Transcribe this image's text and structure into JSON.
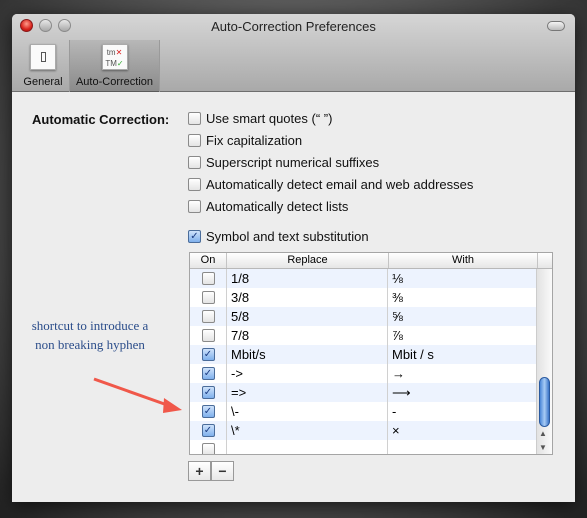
{
  "window": {
    "title": "Auto-Correction Preferences"
  },
  "toolbar": {
    "tabs": [
      {
        "label": "General",
        "selected": false
      },
      {
        "label": "Auto-Correction",
        "selected": true
      }
    ],
    "autocorrect_icon": {
      "top": "tm",
      "bottom": "TM"
    }
  },
  "section": {
    "label": "Automatic Correction:"
  },
  "options": [
    {
      "label": "Use smart quotes (“ ”)",
      "checked": false
    },
    {
      "label": "Fix capitalization",
      "checked": false
    },
    {
      "label": "Superscript numerical suffixes",
      "checked": false
    },
    {
      "label": "Automatically detect email and web addresses",
      "checked": false
    },
    {
      "label": "Automatically detect lists",
      "checked": false
    },
    {
      "label": "Symbol and text substitution",
      "checked": true
    }
  ],
  "table": {
    "headers": [
      "On",
      "Replace",
      "With"
    ],
    "rows": [
      {
        "on": false,
        "replace": "1/8",
        "with": "⅛"
      },
      {
        "on": false,
        "replace": "3/8",
        "with": "⅜"
      },
      {
        "on": false,
        "replace": "5/8",
        "with": "⅝"
      },
      {
        "on": false,
        "replace": "7/8",
        "with": "⅞"
      },
      {
        "on": true,
        "replace": "Mbit/s",
        "with": "Mbit / s"
      },
      {
        "on": true,
        "replace": "->",
        "with": "→"
      },
      {
        "on": true,
        "replace": "=>",
        "with": "⟶"
      },
      {
        "on": true,
        "replace": "\\-",
        "with": "‑"
      },
      {
        "on": true,
        "replace": "\\*",
        "with": "×"
      },
      {
        "on": false,
        "replace": "",
        "with": ""
      }
    ]
  },
  "buttons": {
    "add": "+",
    "remove": "−"
  },
  "annotation": {
    "text": "shortcut to introduce a non breaking hyphen",
    "color": "#2b4d8a",
    "arrow_color": "#f0584a"
  }
}
